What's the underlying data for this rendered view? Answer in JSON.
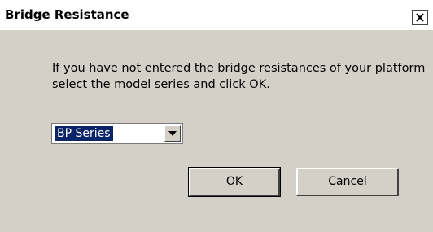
{
  "window": {
    "title": "Bridge Resistance",
    "close_label": "Close"
  },
  "message": "If you have not entered the bridge resistances of your platform select the model series and click OK.",
  "model_select": {
    "selected": "BP Series"
  },
  "buttons": {
    "ok": "OK",
    "cancel": "Cancel"
  },
  "colors": {
    "dialog_bg": "#d4d0c8",
    "selection_bg": "#0a246a",
    "selection_text": "#ffffff"
  },
  "icons": {
    "close": "close-icon",
    "dropdown": "chevron-down-icon"
  }
}
